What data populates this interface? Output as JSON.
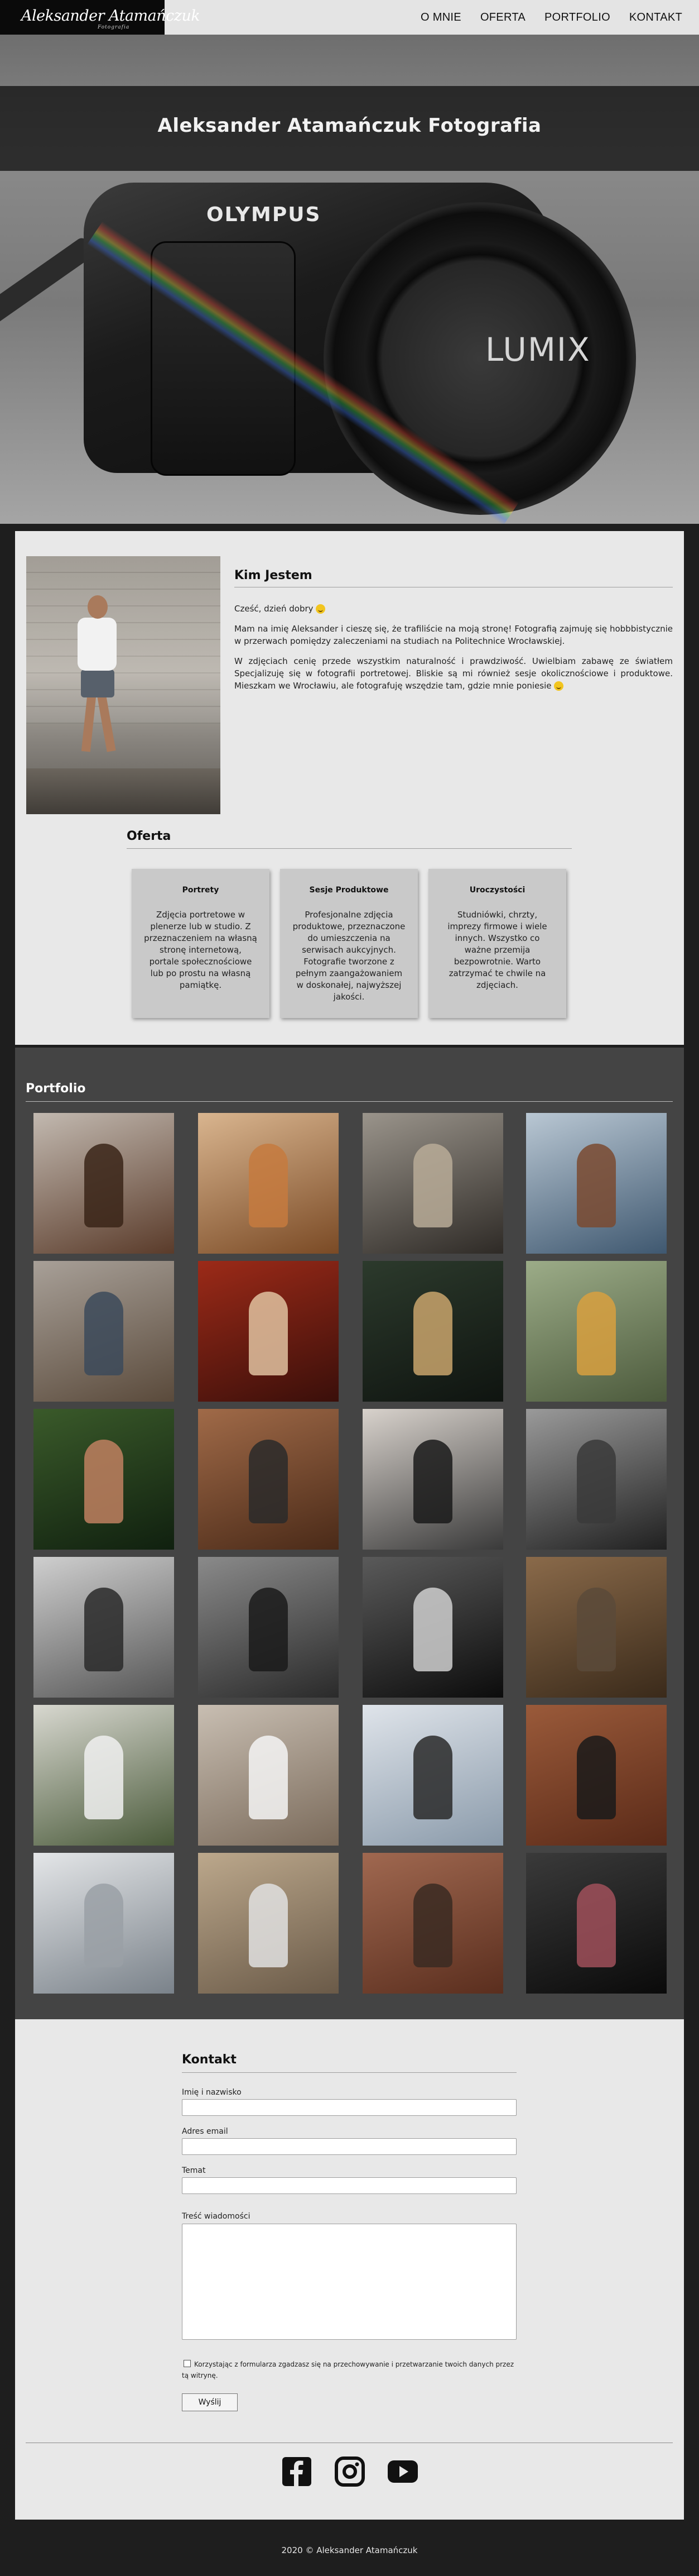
{
  "nav": {
    "logo": "Aleksander Atamańczuk",
    "logo_sub": "Fotografia",
    "links": [
      "O MNIE",
      "OFERTA",
      "PORTFOLIO",
      "KONTAKT"
    ]
  },
  "hero": {
    "title": "Aleksander Atamańczuk Fotografia",
    "camera_brand": "OLYMPUS",
    "lens_brand": "LUMIX"
  },
  "about": {
    "title": "Kim Jestem",
    "paragraphs": [
      "Cześć, dzień dobry",
      "Mam na imię Aleksander i cieszę się, że trafiliście na moją stronę! Fotografią zajmuję się hobbbistycznie w przerwach pomiędzy zaleczeniami na studiach na Politechnice Wrocławskiej.",
      "W zdjęciach cenię przede wszystkim naturalność i prawdziwość. Uwielbiam zabawę ze światłem Specjalizuję się w fotografii portretowej. Bliskie są mi również sesje okolicznościowe i produktowe. Mieszkam we Wrocławiu, ale fotografuję wszędzie tam, gdzie mnie poniesie"
    ]
  },
  "offer": {
    "title": "Oferta",
    "cards": [
      {
        "title": "Portrety",
        "text": "Zdjęcia portretowe w plenerze lub w studio. Z przeznaczeniem na własną stronę internetową, portale społecznościowe lub po prostu na własną pamiątkę."
      },
      {
        "title": "Sesje Produktowe",
        "text": "Profesjonalne zdjęcia produktowe, przeznaczone do umieszczenia na serwisach aukcyjnych. Fotografie tworzone z pełnym zaangażowaniem w doskonałej, najwyższej jakości."
      },
      {
        "title": "Uroczystości",
        "text": "Studniówki, chrzty, imprezy firmowe i wiele innych. Wszystko co ważne przemija bezpowrotnie. Warto zatrzymać te chwile na zdjęciach."
      }
    ]
  },
  "portfolio": {
    "title": "Portfolio",
    "tiles": [
      {
        "c1": "#5a3b2a",
        "c2": "#c2b9b0",
        "fig": "#3a2518"
      },
      {
        "c1": "#7a4a25",
        "c2": "#d9b58f",
        "fig": "#c67a3e"
      },
      {
        "c1": "#2e2a26",
        "c2": "#9a948b",
        "fig": "#b8ab98"
      },
      {
        "c1": "#3f5870",
        "c2": "#b9c7d3",
        "fig": "#7a4a30"
      },
      {
        "c1": "#5a4a3b",
        "c2": "#a8a098",
        "fig": "#3c4a5a"
      },
      {
        "c1": "#3a0f0a",
        "c2": "#9c2a18",
        "fig": "#e0c2a0"
      },
      {
        "c1": "#0f1410",
        "c2": "#2c3a2c",
        "fig": "#c9a56c"
      },
      {
        "c1": "#4c5a3c",
        "c2": "#9cac88",
        "fig": "#d8a040"
      },
      {
        "c1": "#10200f",
        "c2": "#3a5a2a",
        "fig": "#c08060"
      },
      {
        "c1": "#4a2a18",
        "c2": "#a06a48",
        "fig": "#2a2a2a"
      },
      {
        "c1": "#3a3a3a",
        "c2": "#d8d2cc",
        "fig": "#1a1a1a"
      },
      {
        "c1": "#202020",
        "c2": "#9a9a9a",
        "fig": "#3a3a3a"
      },
      {
        "c1": "#555555",
        "c2": "#cfcfcf",
        "fig": "#2a2a2a"
      },
      {
        "c1": "#2a2a2a",
        "c2": "#8a8a8a",
        "fig": "#1a1a1a"
      },
      {
        "c1": "#0c0c0c",
        "c2": "#5a5a5a",
        "fig": "#cfcfcf"
      },
      {
        "c1": "#3a2a1a",
        "c2": "#8a6a4a",
        "fig": "#5a4a3a"
      },
      {
        "c1": "#4a5a3a",
        "c2": "#d8d8d0",
        "fig": "#f0f0f0"
      },
      {
        "c1": "#7a6a5a",
        "c2": "#c8beb2",
        "fig": "#f4f4f4"
      },
      {
        "c1": "#8a9aaa",
        "c2": "#dfe4ea",
        "fig": "#2a2a2a"
      },
      {
        "c1": "#5a2a18",
        "c2": "#9a5a3a",
        "fig": "#1a1a1a"
      },
      {
        "c1": "#7a828a",
        "c2": "#e4e6e8",
        "fig": "#9aa0a6"
      },
      {
        "c1": "#6a5a48",
        "c2": "#bca88c",
        "fig": "#e0e0e0"
      },
      {
        "c1": "#5a2e1e",
        "c2": "#a06850",
        "fig": "#3a2a22"
      },
      {
        "c1": "#0a0a0a",
        "c2": "#3a3a3a",
        "fig": "#a0505a"
      }
    ]
  },
  "contact": {
    "title": "Kontakt",
    "name_label": "Imię i nazwisko",
    "email_label": "Adres email",
    "subject_label": "Temat",
    "message_label": "Treść wiadomości",
    "consent": "Korzystając z formularza zgadzasz się na przechowywanie i przetwarzanie twoich danych przez tą witrynę.",
    "submit": "Wyślij"
  },
  "footer": {
    "text": "2020 © Aleksander Atamańczuk"
  }
}
